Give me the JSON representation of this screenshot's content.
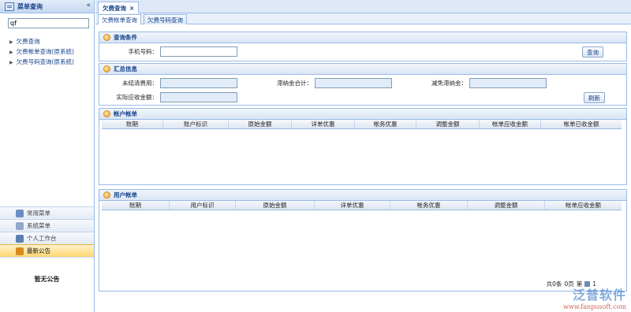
{
  "sidebar": {
    "title": "菜单查询",
    "collapse_icon": "«",
    "search_value": "qf",
    "tree": [
      {
        "label": "欠费查询"
      },
      {
        "label": "欠费帐单查询(原系统)"
      },
      {
        "label": "欠费号码查询(原系统)"
      }
    ],
    "nav": [
      {
        "label": "常用菜单",
        "icon": "common-menu-icon"
      },
      {
        "label": "系统菜单",
        "icon": "system-menu-icon"
      },
      {
        "label": "个人工作台",
        "icon": "workbench-icon"
      },
      {
        "label": "最新公告",
        "icon": "announcement-icon"
      }
    ],
    "notice": "暂无公告"
  },
  "main": {
    "tab_label": "欠费查询",
    "tab_close": "×",
    "subtabs": [
      "欠费帐单查询",
      "欠费号码查询"
    ],
    "query_panel": {
      "title": "查询条件",
      "phone_label": "手机号码：",
      "phone_value": "",
      "query_button": "查询"
    },
    "summary_panel": {
      "title": "汇总信息",
      "unsettled_label": "未结清费用：",
      "late_fee_label": "滞纳金合计：",
      "waived_label": "减免滞纳金：",
      "receivable_label": "实际应收金额：",
      "refresh_button": "刷新"
    },
    "account_bill": {
      "title": "帐户帐单",
      "columns": [
        "账期",
        "账户标识",
        "原始金额",
        "详单优惠",
        "帐务优惠",
        "调整金额",
        "帐单应收金额",
        "帐单已收金额"
      ]
    },
    "user_bill": {
      "title": "用户帐单",
      "columns": [
        "账期",
        "用户标识",
        "原始金额",
        "详单优惠",
        "帐务优惠",
        "调整金额",
        "帐单应收金额"
      ],
      "pager": {
        "total": "共0条",
        "pages": "0页",
        "page": "第",
        "extra": "1"
      }
    }
  },
  "watermark": {
    "main": "泛普软件",
    "url": "www.fanpusoft.com"
  }
}
